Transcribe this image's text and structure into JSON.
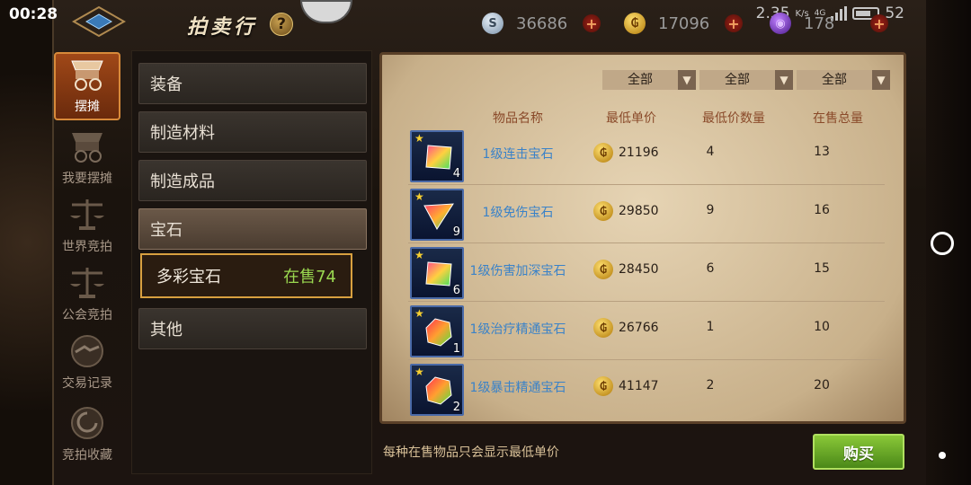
{
  "status": {
    "time": "00:28",
    "speed": "2.35",
    "speed_unit": "K/s",
    "battery": "52",
    "network": "4G"
  },
  "header": {
    "title": "拍卖行",
    "help_label": "?"
  },
  "currencies": [
    {
      "icon": "silver-coin-icon",
      "symbol": "S",
      "value": "36686"
    },
    {
      "icon": "gold-coin-icon",
      "symbol": "₲",
      "value": "17096"
    },
    {
      "icon": "purple-gem-icon",
      "symbol": "◉",
      "value": "178"
    }
  ],
  "nav": [
    {
      "label": "摆摊",
      "icon": "stall-cart-icon",
      "active": true
    },
    {
      "label": "我要摆摊",
      "icon": "cart-icon",
      "active": false
    },
    {
      "label": "世界竞拍",
      "icon": "scales-icon",
      "active": false
    },
    {
      "label": "公会竞拍",
      "icon": "guild-scales-icon",
      "active": false
    },
    {
      "label": "交易记录",
      "icon": "handshake-icon",
      "active": false
    },
    {
      "label": "竞拍收藏",
      "icon": "collection-icon",
      "active": false
    }
  ],
  "categories": [
    {
      "label": "装备"
    },
    {
      "label": "制造材料"
    },
    {
      "label": "制造成品"
    },
    {
      "label": "宝石"
    },
    {
      "label": "其他"
    }
  ],
  "subcategory": {
    "label": "多彩宝石",
    "count": "在售74"
  },
  "filters": [
    "全部",
    "全部",
    "全部"
  ],
  "columns": {
    "name": "物品名称",
    "price": "最低单价",
    "min_qty": "最低价数量",
    "total": "在售总量"
  },
  "rows": [
    {
      "name": "1级连击宝石",
      "qty_badge": "4",
      "price": "21196",
      "min_qty": "4",
      "total": "13",
      "gem": "square-pink"
    },
    {
      "name": "1级免伤宝石",
      "qty_badge": "9",
      "price": "29850",
      "min_qty": "9",
      "total": "16",
      "gem": "triangle"
    },
    {
      "name": "1级伤害加深宝石",
      "qty_badge": "6",
      "price": "28450",
      "min_qty": "6",
      "total": "15",
      "gem": "square-pink"
    },
    {
      "name": "1级治疗精通宝石",
      "qty_badge": "1",
      "price": "26766",
      "min_qty": "1",
      "total": "10",
      "gem": "shard"
    },
    {
      "name": "1级暴击精通宝石",
      "qty_badge": "2",
      "price": "41147",
      "min_qty": "2",
      "total": "20",
      "gem": "shard"
    }
  ],
  "footer": {
    "note": "每种在售物品只会显示最低单价",
    "buy_label": "购买"
  }
}
